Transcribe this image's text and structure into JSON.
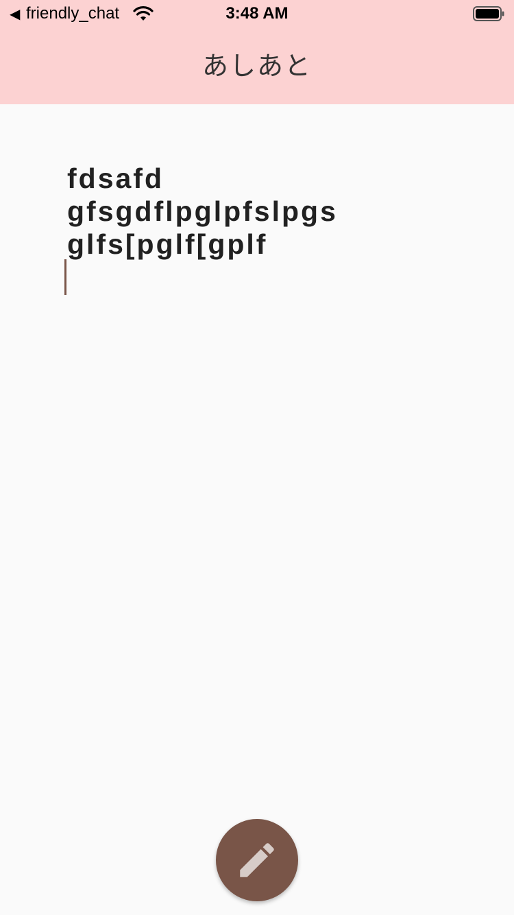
{
  "status_bar": {
    "back_chevron": "◀",
    "back_app_label": "friendly_chat",
    "time": "3:48 AM",
    "wifi_icon": "wifi-icon",
    "battery_icon": "battery-icon"
  },
  "app_bar": {
    "title": "あしあと",
    "background_color": "#fcd2d2"
  },
  "editor": {
    "lines": [
      "fdsafd",
      "gfsgdflpglpfslpgs",
      "glfs[pglf[gplf"
    ],
    "text_color": "#212121",
    "cursor_color": "#795548"
  },
  "fab": {
    "icon": "pencil-icon",
    "color": "#795548",
    "icon_color": "#d7ccc8"
  }
}
